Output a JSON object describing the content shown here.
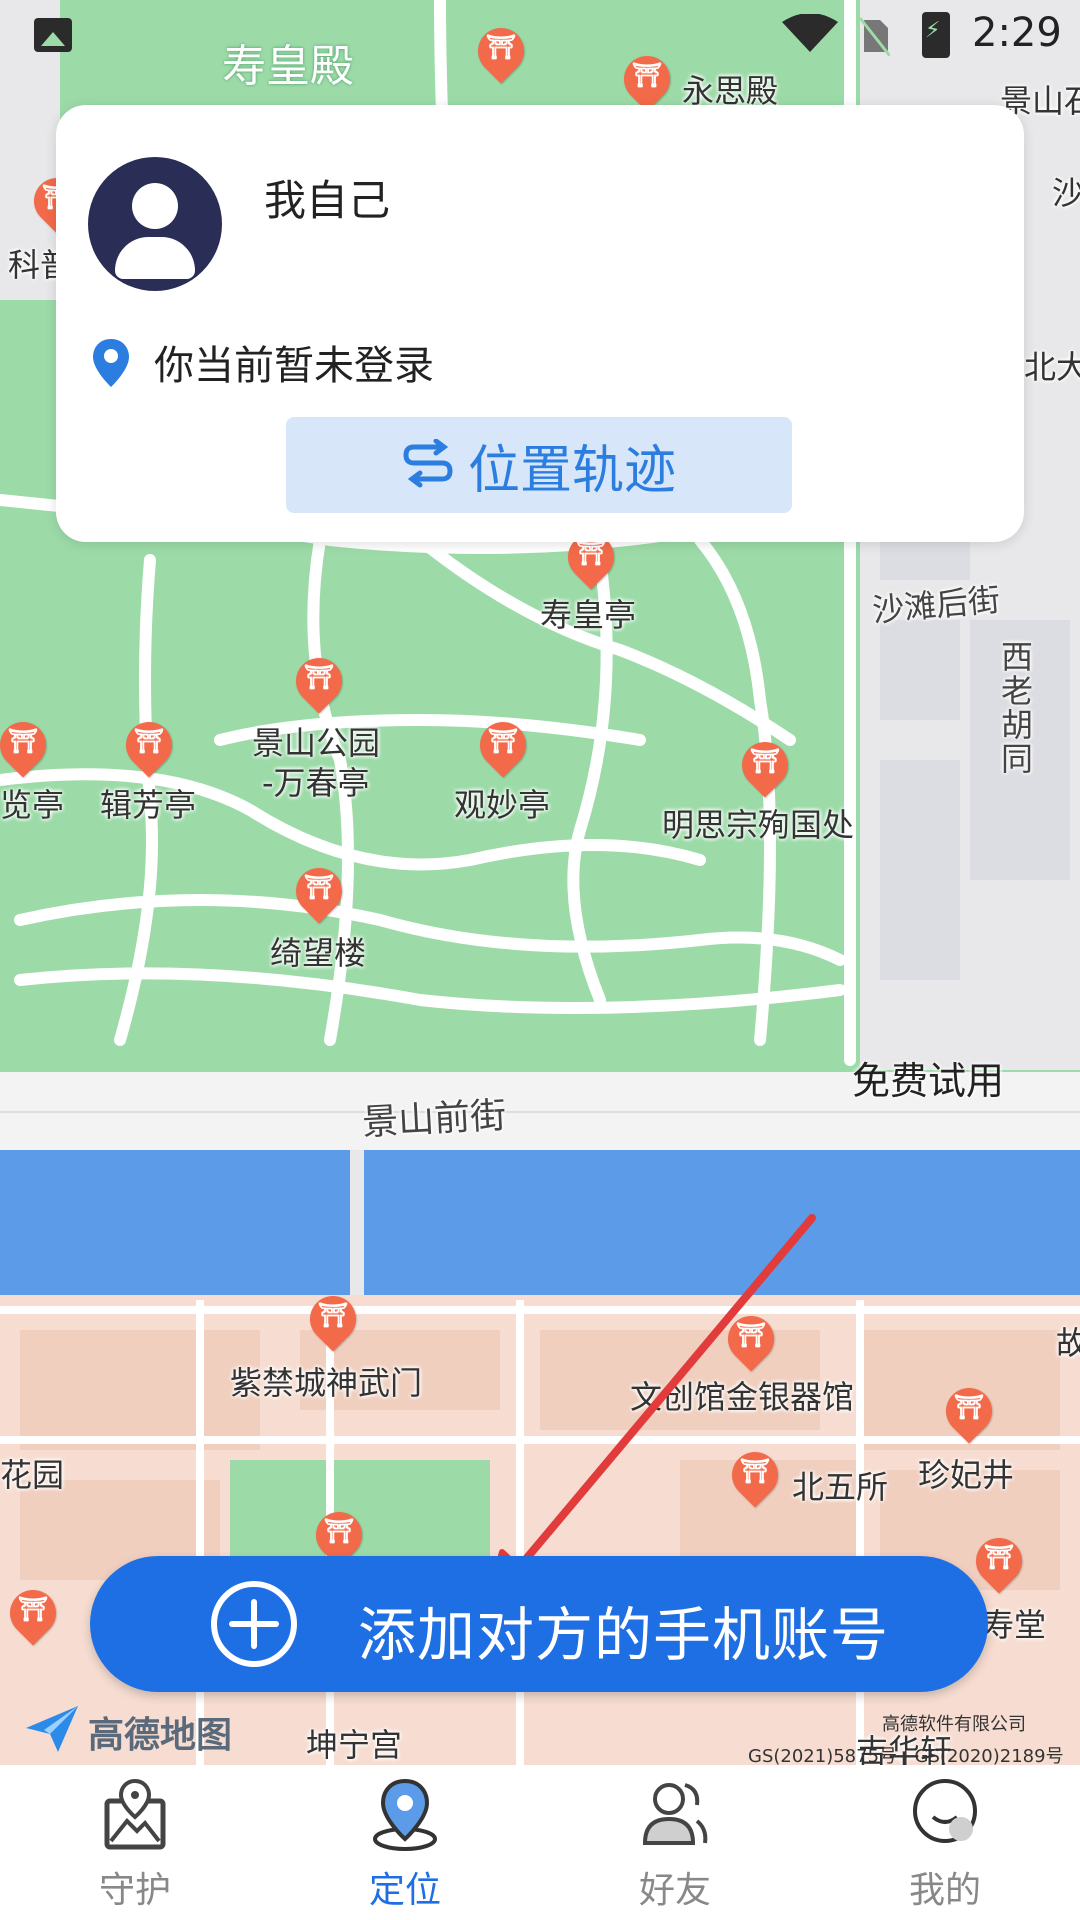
{
  "status_bar": {
    "time": "2:29"
  },
  "map": {
    "labels": {
      "shouhuangdian": "寿皇殿",
      "yongsidian": "永思殿",
      "jingshanhotel": "景山石",
      "kepu": "科普",
      "beida": "北大",
      "sha": "沙",
      "shouhuangting": "寿皇亭",
      "shatanhoujie": "沙滩后街",
      "xilaohutong": "西老胡同",
      "jingshanpark": "景山公园",
      "wanchunting": "-万春亭",
      "guanmiaoting": "观妙亭",
      "mingsizong": "明思宗殉国处",
      "jifangting": "辑芳亭",
      "lanting": "览亭",
      "qiwanglou": "绮望楼",
      "jingshanqianjie": "景山前街",
      "shenwumen": "紫禁城神武门",
      "wenchuang": "文创馆金银器馆",
      "beiwusuo": "北五所",
      "zhenfeijing": "珍妃井",
      "huayuan": "花园",
      "gu": "故",
      "shoutang": "寿堂",
      "kunninggong": "坤宁宫",
      "jihuaxuan": "吉华轩"
    }
  },
  "card": {
    "user_name": "我自己",
    "login_status": "你当前暂未登录",
    "track_button": "位置轨迹"
  },
  "free_trial": "免费试用",
  "add_button": "添加对方的手机账号",
  "amap": {
    "logo_text": "高德地图",
    "copyright_company": "高德软件有限公司",
    "copyright_numbers": "GS(2021)5875号 | GS(2020)2189号"
  },
  "nav": {
    "items": [
      {
        "label": "守护",
        "icon": "map-photo-icon"
      },
      {
        "label": "定位",
        "icon": "location-icon"
      },
      {
        "label": "好友",
        "icon": "friends-icon"
      },
      {
        "label": "我的",
        "icon": "profile-icon"
      }
    ],
    "active": "定位"
  },
  "colors": {
    "accent": "#1e6fe3",
    "park_green": "#9cdba8",
    "water": "#5b9be8",
    "arrow": "#e23b3b"
  }
}
